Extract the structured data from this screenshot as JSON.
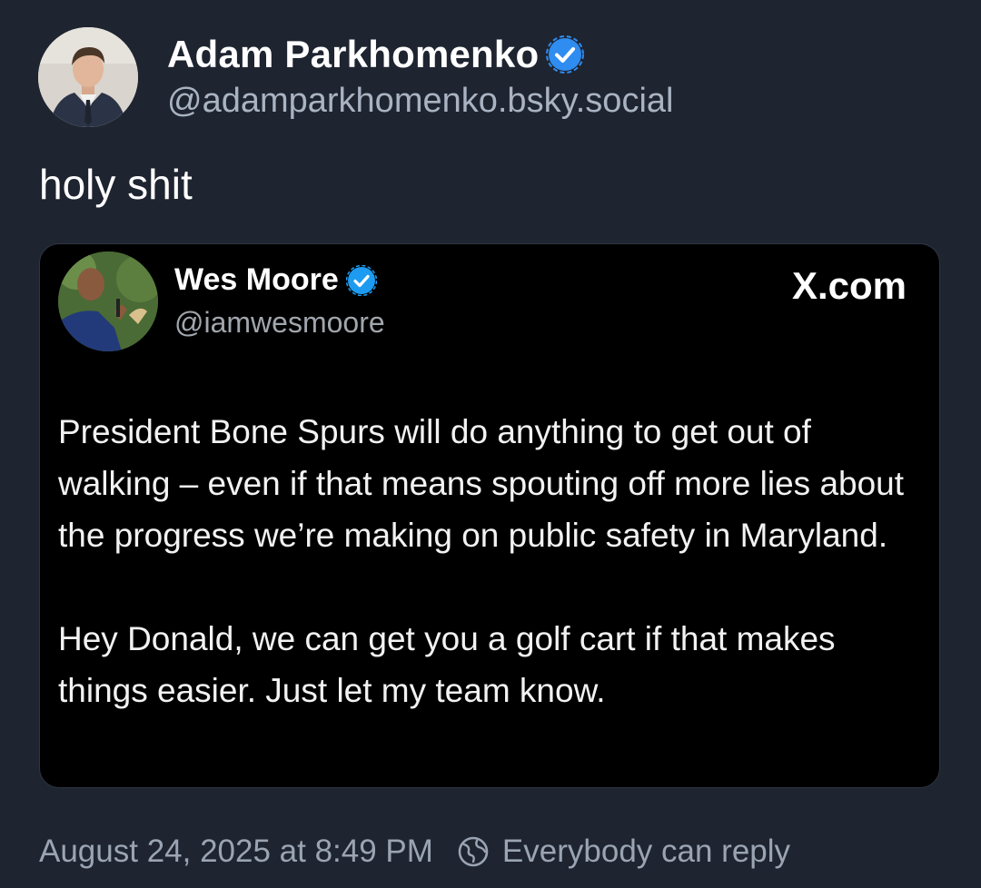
{
  "author": {
    "display_name": "Adam Parkhomenko",
    "handle": "@adamparkhomenko.bsky.social",
    "avatar_icon": "avatar-photo",
    "verified_icon": "verified-check-icon",
    "verified_color": "#1d9bf0"
  },
  "post": {
    "text": "holy shit"
  },
  "embed": {
    "display_name": "Wes Moore",
    "handle": "@iamwesmoore",
    "source": "X.com",
    "avatar_icon": "avatar-photo",
    "verified_icon": "verified-check-icon",
    "paragraphs": [
      "President Bone Spurs will do anything to get out of walking – even if that means spouting off more lies about the progress we’re making on public safety in Maryland.",
      "Hey Donald, we can get you a golf cart if that makes things easier. Just let my team know."
    ]
  },
  "footer": {
    "timestamp": "August 24, 2025 at 8:49 PM",
    "reply_setting": "Everybody can reply",
    "reply_icon": "globe-icon"
  },
  "colors": {
    "background": "#1e2430",
    "embed_background": "#000000",
    "secondary_text": "#a9b3c1"
  }
}
